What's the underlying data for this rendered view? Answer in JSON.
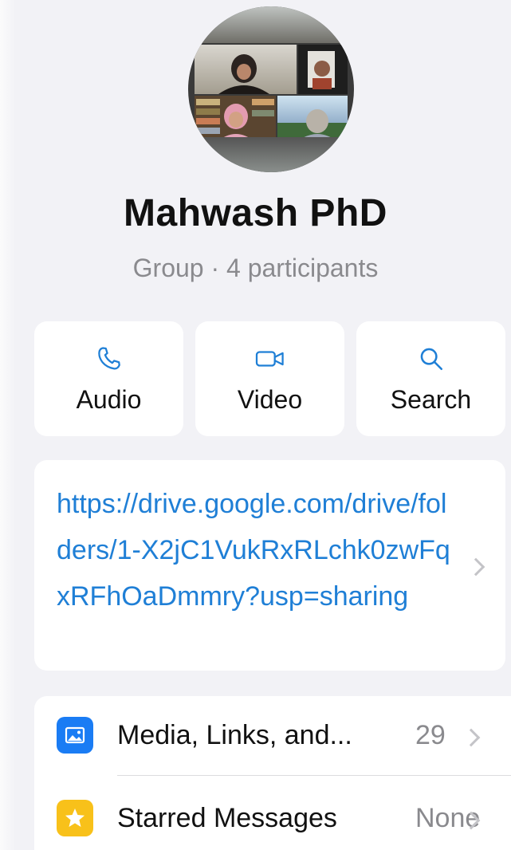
{
  "group": {
    "name": "Mahwash PhD",
    "subtitle": "Group · 4 participants"
  },
  "actions": [
    {
      "label": "Audio",
      "icon": "phone-icon"
    },
    {
      "label": "Video",
      "icon": "video-camera-icon"
    },
    {
      "label": "Search",
      "icon": "search-icon"
    }
  ],
  "description_link": "https://drive.google.com/drive/folders/1-X2jC1VukRxRLchk0zwFqxRFhOaDmmry?usp=sharing",
  "list": [
    {
      "label": "Media, Links, and...",
      "value": "29",
      "icon": "photo-icon",
      "icon_color": "#1a7cf4"
    },
    {
      "label": "Starred Messages",
      "value": "None",
      "icon": "star-icon",
      "icon_color": "#f8c11a"
    }
  ],
  "colors": {
    "accent": "#1f7fd6",
    "background": "#f2f2f6"
  }
}
